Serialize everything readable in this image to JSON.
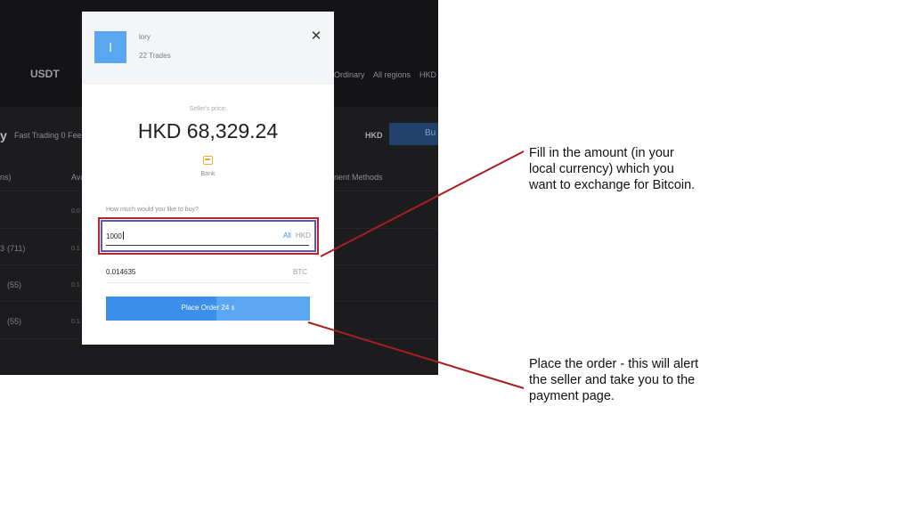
{
  "background": {
    "coin": "USDT",
    "filters": [
      "Ordinary",
      "All regions",
      "HKD"
    ],
    "side_fragment": "y",
    "fee_text": "Fast Trading 0 Fee",
    "currency_tab": "HKD",
    "buy_button_fragment": "Bu",
    "columns": [
      "ns)",
      "Ava",
      "nent Methods"
    ],
    "rows": [
      {
        "count": "",
        "value": "0.0"
      },
      {
        "count": "(711)",
        "value": "0.1"
      },
      {
        "count": "(55)",
        "value": "0.1"
      },
      {
        "count": "(55)",
        "value": "0.1"
      }
    ],
    "row_count_prefix": "3"
  },
  "modal": {
    "avatar_letter": "l",
    "seller_name": "lory",
    "trades": "22 Trades",
    "close_symbol": "✕",
    "price_label": "Seller's price:",
    "price": "HKD 68,329.24",
    "payment_method": "Bank",
    "question": "How much would you like to buy?",
    "amount": "1000",
    "all_label": "All",
    "fiat_currency": "HKD",
    "crypto_amount": "0.014635",
    "crypto_currency": "BTC",
    "order_button": "Place Order  24 s",
    "countdown_progress": 0.54
  },
  "annotations": {
    "amount_note": "Fill in the amount (in your local currency) which you want to exchange for Bitcoin.",
    "order_note": "Place the order - this will alert the seller and take you to the payment page."
  },
  "colors": {
    "accent": "#3b8fea",
    "highlight": "#b8262c",
    "annotation_line": "#a61e22"
  }
}
